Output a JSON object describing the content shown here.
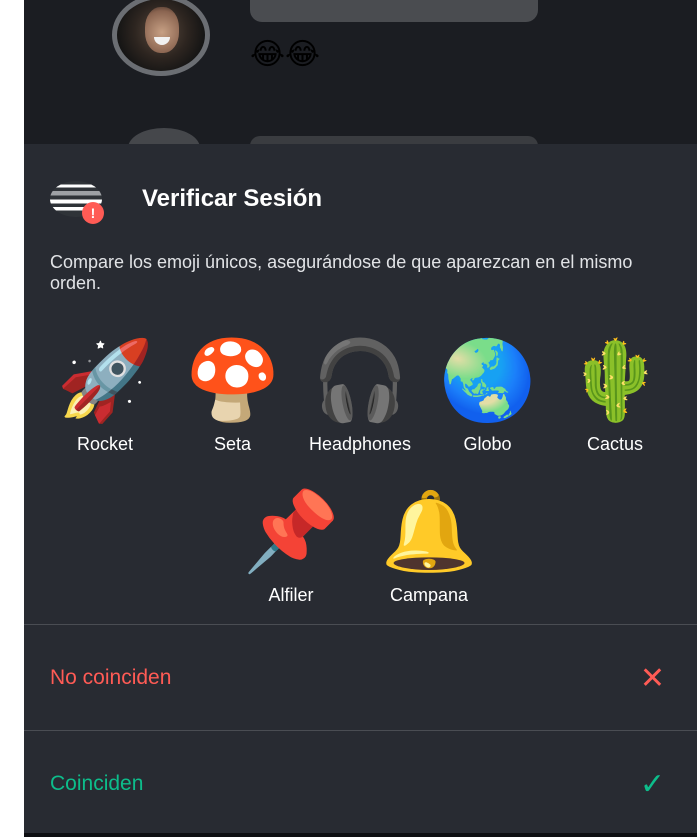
{
  "chat": {
    "reaction": "😂😂"
  },
  "dialog": {
    "title": "Verificar Sesión",
    "badge": "!",
    "description": "Compare los emoji únicos, asegurándose de que aparezcan en el mismo orden.",
    "emoji_row1": [
      {
        "glyph": "🚀",
        "label": "Rocket"
      },
      {
        "glyph": "🍄",
        "label": "Seta"
      },
      {
        "glyph": "🎧",
        "label": "Headphones"
      },
      {
        "glyph": "🌏",
        "label": "Globo"
      },
      {
        "glyph": "🌵",
        "label": "Cactus"
      }
    ],
    "emoji_row2": [
      {
        "glyph": "📌",
        "label": "Alfiler"
      },
      {
        "glyph": "🔔",
        "label": "Campana"
      }
    ]
  },
  "actions": {
    "mismatch": {
      "label": "No coinciden",
      "icon": "close-icon",
      "glyph": "✕",
      "color": "#ff5b55"
    },
    "match": {
      "label": "Coinciden",
      "icon": "checkmark-icon",
      "glyph": "✓",
      "color": "#0dbd8b"
    }
  }
}
